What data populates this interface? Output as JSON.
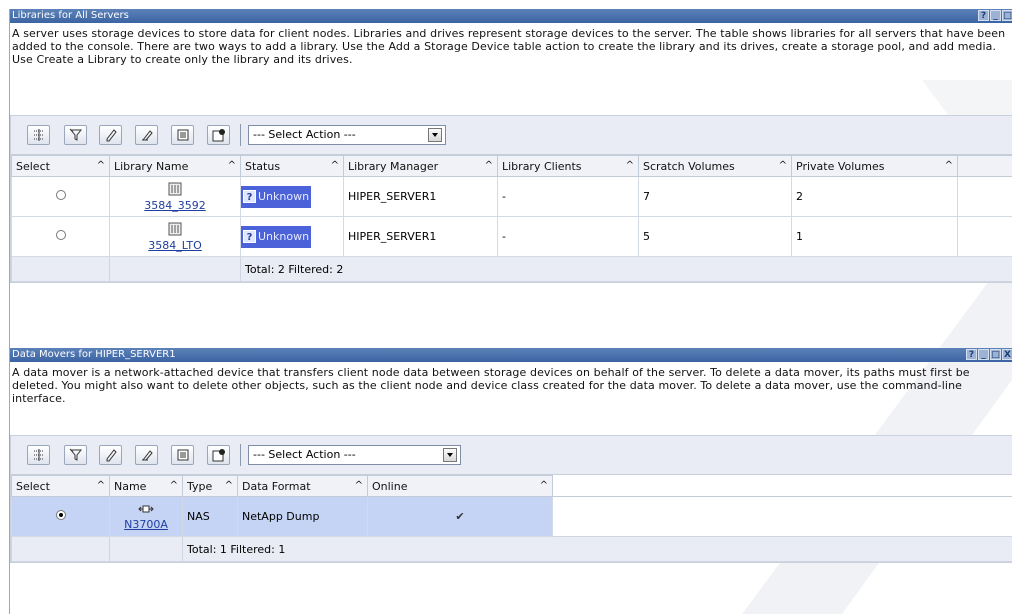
{
  "libraries_portlet": {
    "title": "Libraries for All Servers",
    "title_icons": [
      "?",
      "_",
      "□"
    ],
    "description": "A server uses storage devices to store data for client nodes. Libraries and drives represent storage devices to the server. The table shows libraries for all servers that have been added to the console. There are two ways to add a library. Use the Add a Storage Device table action to create the library and its drives, create a storage pool, and add media. Use Create a Library to create only the library and its drives.",
    "select_action": "--- Select Action ---",
    "columns": [
      "Select",
      "Library Name",
      "Status",
      "Library Manager",
      "Library Clients",
      "Scratch Volumes",
      "Private Volumes"
    ],
    "sort_glyph": "^",
    "rows": [
      {
        "selected": false,
        "library_name": "3584_3592",
        "status": "Unknown",
        "library_manager": "HIPER_SERVER1",
        "library_clients": "-",
        "scratch_volumes": "7",
        "private_volumes": "2"
      },
      {
        "selected": false,
        "library_name": "3584_LTO",
        "status": "Unknown",
        "library_manager": "HIPER_SERVER1",
        "library_clients": "-",
        "scratch_volumes": "5",
        "private_volumes": "1"
      }
    ],
    "footer": "Total: 2   Filtered: 2"
  },
  "datamovers_portlet": {
    "title": "Data Movers for HIPER_SERVER1",
    "title_icons": [
      "?",
      "_",
      "□",
      "X"
    ],
    "description": "A data mover is a network-attached device that transfers client node data between storage devices on behalf of the server. To delete a data mover, its paths must first be deleted. You might also want to delete other objects, such as the client node and device class created for the data mover. To delete a data mover, use the command-line interface.",
    "select_action": "--- Select Action ---",
    "columns": [
      "Select",
      "Name",
      "Type",
      "Data Format",
      "Online"
    ],
    "sort_glyph": "^",
    "rows": [
      {
        "selected": true,
        "name": "N3700A",
        "type": "NAS",
        "data_format": "NetApp Dump",
        "online": "✔"
      }
    ],
    "footer": "Total: 1   Filtered: 1"
  },
  "toolbar_icons": [
    "expand-columns-icon",
    "filter-icon",
    "edit-icon",
    "clear-filter-icon",
    "collapse-table-icon",
    "settings-icon"
  ],
  "colors": {
    "titlebar": "#3b64a3",
    "status_unknown": "#4b62d8",
    "selected_row": "#c5d4f5",
    "toolbar_bg": "#e9ecf4"
  }
}
